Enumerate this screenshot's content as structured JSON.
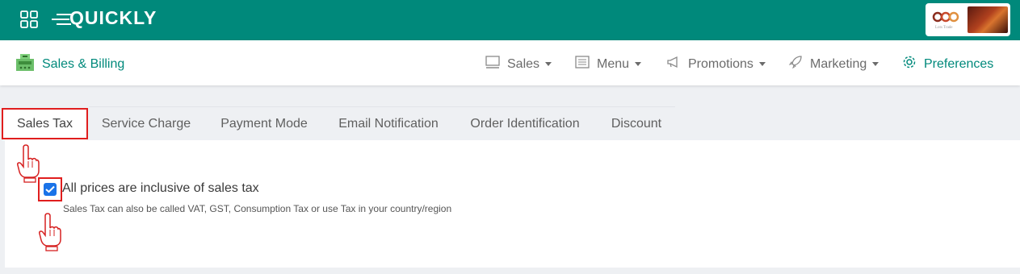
{
  "header": {
    "logo_text": "QUICKLY",
    "brand_card_text": "Lots Trade"
  },
  "nav": {
    "app_title": "Sales & Billing",
    "items": [
      {
        "label": "Sales",
        "icon": "pos-icon"
      },
      {
        "label": "Menu",
        "icon": "menu-list-icon"
      },
      {
        "label": "Promotions",
        "icon": "megaphone-icon"
      },
      {
        "label": "Marketing",
        "icon": "rocket-icon"
      },
      {
        "label": "Preferences",
        "icon": "gear-icon"
      }
    ]
  },
  "tabs": [
    {
      "label": "Sales Tax",
      "active": true
    },
    {
      "label": "Service Charge"
    },
    {
      "label": "Payment Mode"
    },
    {
      "label": "Email Notification"
    },
    {
      "label": "Order Identification"
    },
    {
      "label": "Discount"
    }
  ],
  "sales_tax": {
    "checkbox_label": "All prices are inclusive of sales tax",
    "checked": true,
    "helper_text": "Sales Tax can also be called VAT, GST, Consumption Tax or use Tax in your country/region"
  },
  "colors": {
    "brand": "#00897b",
    "highlight": "#e01e1e",
    "checkbox": "#1a73e8"
  }
}
